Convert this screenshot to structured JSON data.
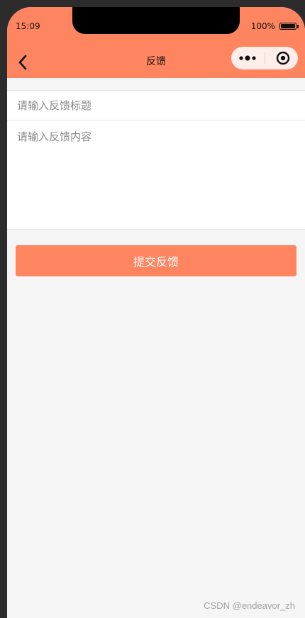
{
  "status_bar": {
    "time": "15:09",
    "battery_text": "100%"
  },
  "nav": {
    "title": "反馈",
    "back_icon": "chevron-left-icon",
    "more_icon": "more-dots-icon",
    "close_icon": "record-circle-icon"
  },
  "form": {
    "title_placeholder": "请输入反馈标题",
    "content_placeholder": "请输入反馈内容"
  },
  "submit": {
    "label": "提交反馈"
  },
  "watermark": "CSDN @endeavor_zh",
  "colors": {
    "accent": "#ff8561",
    "background": "#f5f5f5",
    "capsule": "#ffeee9"
  }
}
